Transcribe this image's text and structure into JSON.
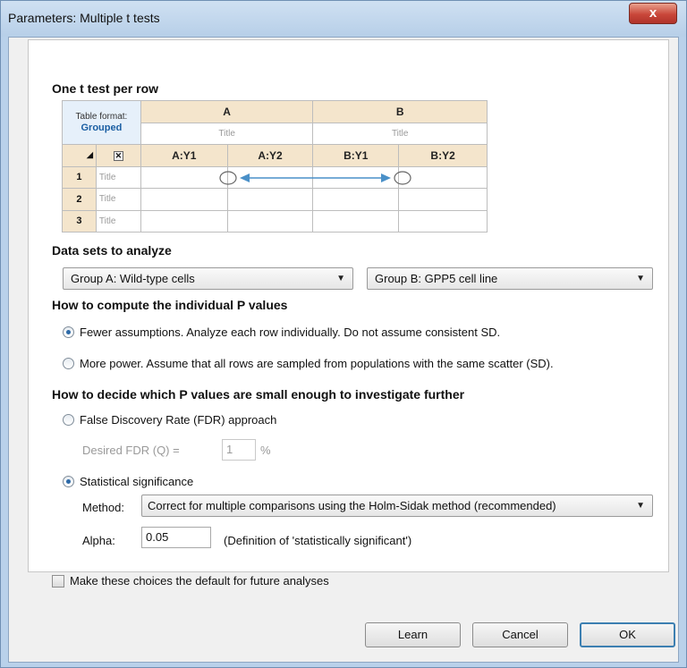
{
  "window": {
    "title": "Parameters: Multiple t tests",
    "close_label": "x"
  },
  "sections": {
    "one_test": "One t test per row",
    "data_sets": "Data sets to analyze",
    "compute_p": "How to compute the individual P values",
    "decide": "How to decide which P values are small enough to investigate further"
  },
  "table": {
    "format_label": "Table format:",
    "format_value": "Grouped",
    "corner_icon": "x-icon",
    "groups": [
      "A",
      "B"
    ],
    "group_titles": [
      "Title",
      "Title"
    ],
    "columns": [
      "A:Y1",
      "A:Y2",
      "B:Y1",
      "B:Y2"
    ],
    "rows": [
      {
        "num": "1",
        "title": "Title"
      },
      {
        "num": "2",
        "title": "Title"
      },
      {
        "num": "3",
        "title": "Title"
      }
    ]
  },
  "data_sets": {
    "group_a": "Group A: Wild-type cells",
    "group_b": "Group B: GPP5 cell line"
  },
  "compute": {
    "fewer": "Fewer assumptions. Analyze each row individually. Do not assume consistent SD.",
    "more": "More power. Assume that all rows are sampled from populations with the  same scatter (SD)."
  },
  "decide": {
    "fdr": "False Discovery Rate (FDR) approach",
    "desired_fdr_label": "Desired FDR (Q) =",
    "desired_fdr_value": "1",
    "percent": "%",
    "stat_sig": "Statistical significance",
    "method_label": "Method:",
    "method_value": "Correct for multiple comparisons using the Holm-Sidak method (recommended)",
    "alpha_label": "Alpha:",
    "alpha_value": "0.05",
    "alpha_note": "(Definition of 'statistically significant')"
  },
  "default_check": "Make these choices the default for future analyses",
  "buttons": {
    "learn": "Learn",
    "cancel": "Cancel",
    "ok": "OK"
  },
  "colors": {
    "accent": "#2d6aa8",
    "header_tan": "#f4e5cc",
    "arrow": "#4a90c8"
  }
}
